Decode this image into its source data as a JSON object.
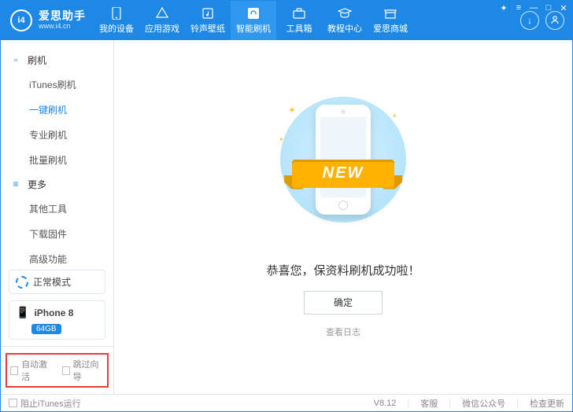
{
  "brand": {
    "logo": "i4",
    "title": "爱思助手",
    "subtitle": "www.i4.cn"
  },
  "titleButtons": {
    "gift": "⛶",
    "menu": "≡",
    "min": "—",
    "max": "□",
    "close": "✕"
  },
  "circleButtons": {
    "download": "↓",
    "user": "👤"
  },
  "tabs": [
    {
      "label": "我的设备",
      "icon": "phone"
    },
    {
      "label": "应用游戏",
      "icon": "apps"
    },
    {
      "label": "铃声壁纸",
      "icon": "music"
    },
    {
      "label": "智能刷机",
      "icon": "flash",
      "active": true
    },
    {
      "label": "工具箱",
      "icon": "toolbox"
    },
    {
      "label": "教程中心",
      "icon": "tutorial"
    },
    {
      "label": "爱思商城",
      "icon": "store"
    }
  ],
  "sidebar": {
    "groups": [
      {
        "title": "刷机",
        "icon": "▢",
        "items": [
          "iTunes刷机",
          "一键刷机",
          "专业刷机",
          "批量刷机"
        ],
        "activeIndex": 1
      },
      {
        "title": "更多",
        "icon": "≡",
        "items": [
          "其他工具",
          "下载固件",
          "高级功能"
        ]
      }
    ],
    "mode": "正常模式",
    "device": {
      "name": "iPhone 8",
      "storage": "64GB"
    },
    "bottomOptions": [
      "自动激活",
      "跳过向导"
    ]
  },
  "main": {
    "ribbon": "NEW",
    "successText": "恭喜您，保资料刷机成功啦！",
    "okLabel": "确定",
    "viewLog": "查看日志"
  },
  "statusbar": {
    "blockItunes": "阻止iTunes运行",
    "version": "V8.12",
    "links": [
      "客服",
      "微信公众号",
      "检查更新"
    ]
  }
}
